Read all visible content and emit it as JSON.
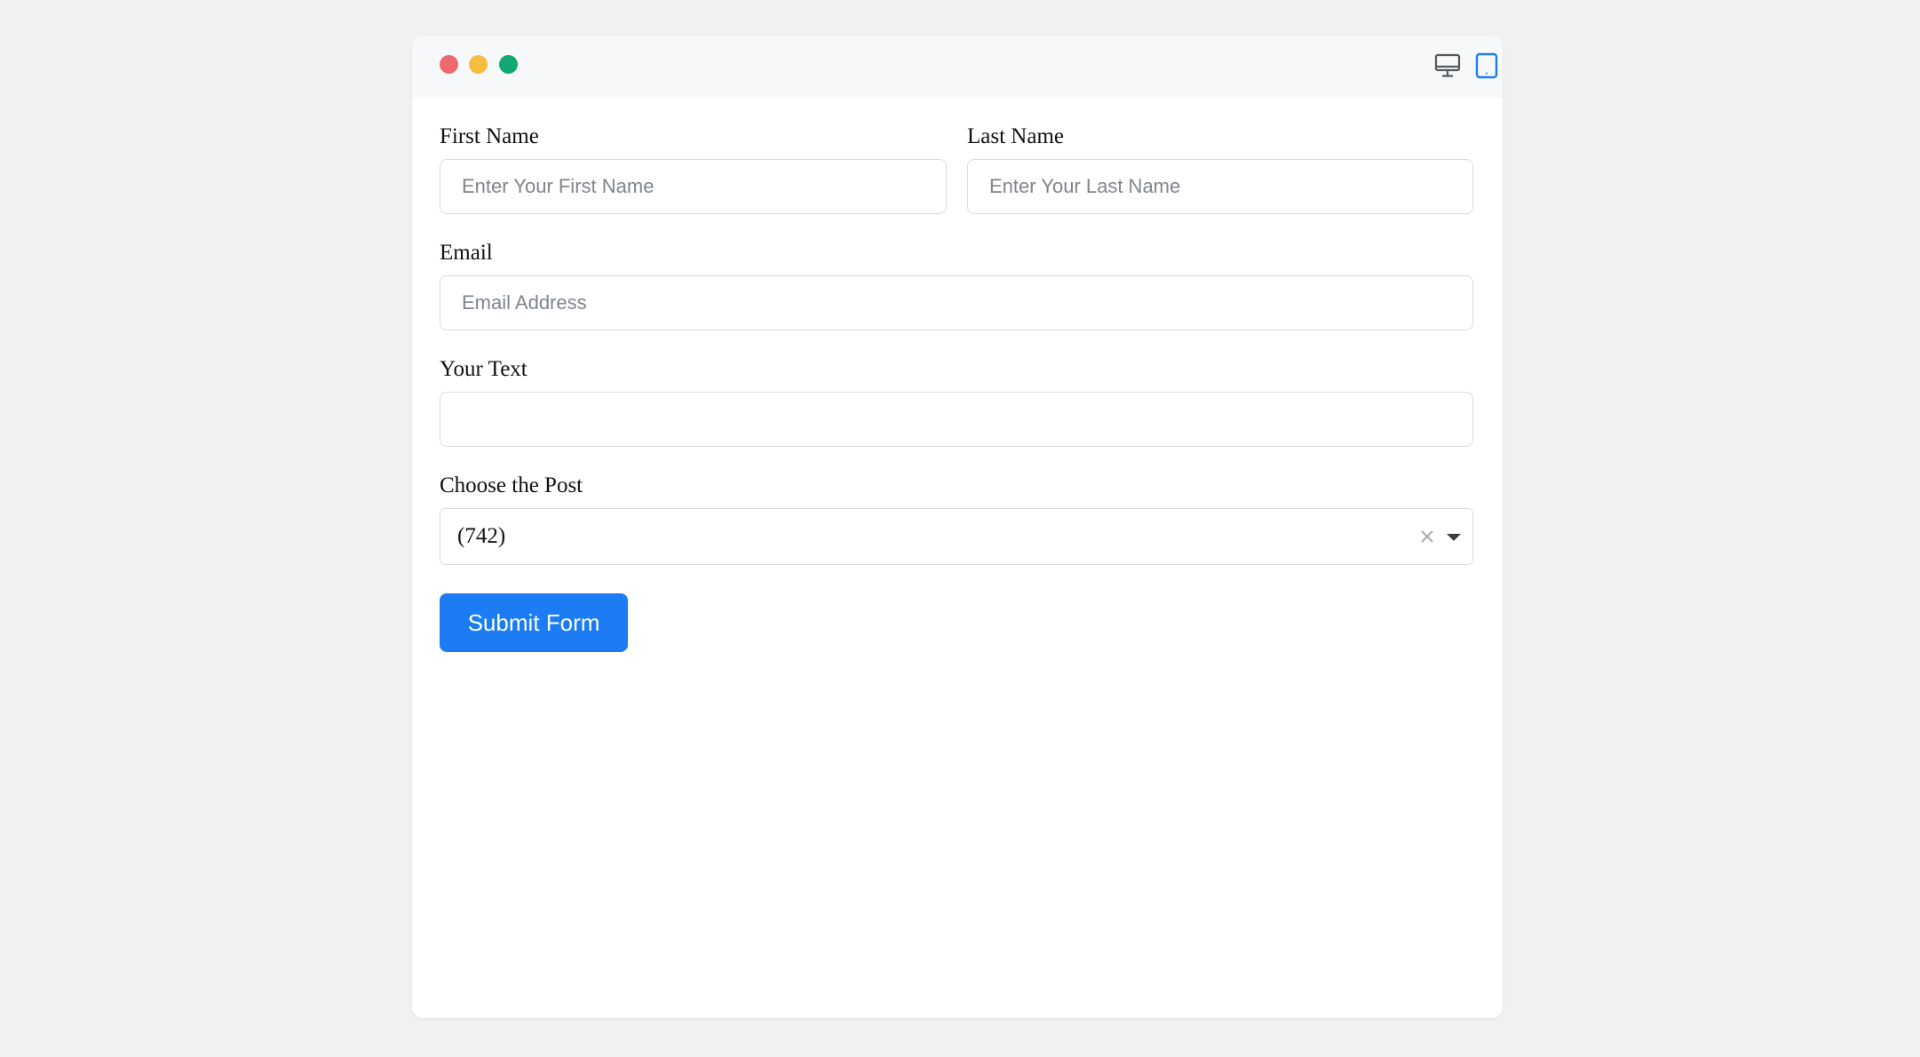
{
  "window": {
    "controls": [
      {
        "name": "close",
        "color": "#ec6a6d"
      },
      {
        "name": "minimize",
        "color": "#f6bd40"
      },
      {
        "name": "maximize",
        "color": "#12a871"
      }
    ],
    "view_toggles": [
      {
        "icon": "desktop-icon",
        "active": false
      },
      {
        "icon": "tablet-icon",
        "active": true
      },
      {
        "icon": "mobile-icon",
        "active": false
      }
    ],
    "accent_color": "#1b7cf3"
  },
  "form": {
    "first_name": {
      "label": "First Name",
      "placeholder": "Enter Your First Name",
      "value": ""
    },
    "last_name": {
      "label": "Last Name",
      "placeholder": "Enter Your Last Name",
      "value": ""
    },
    "email": {
      "label": "Email",
      "placeholder": "Email Address",
      "value": ""
    },
    "your_text": {
      "label": "Your Text",
      "placeholder": "",
      "value": ""
    },
    "post": {
      "label": "Choose the Post",
      "selected": "(742)"
    },
    "submit_label": "Submit Form"
  }
}
